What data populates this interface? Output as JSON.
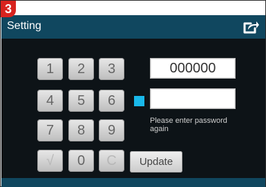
{
  "annotation": {
    "step_badge": "3"
  },
  "header": {
    "title": "Setting",
    "share_icon": "share-icon"
  },
  "keypad": {
    "keys": [
      "1",
      "2",
      "3",
      "4",
      "5",
      "6",
      "7",
      "8",
      "9",
      "√",
      "0",
      "C"
    ]
  },
  "password": {
    "first_field_value": "000000",
    "second_field_value": "",
    "hint": "Please enter password again"
  },
  "actions": {
    "update_label": "Update"
  },
  "colors": {
    "header": "#10475f",
    "content_background": "#0d1317",
    "focus_marker": "#19b8ea",
    "badge": "#d8231f"
  }
}
